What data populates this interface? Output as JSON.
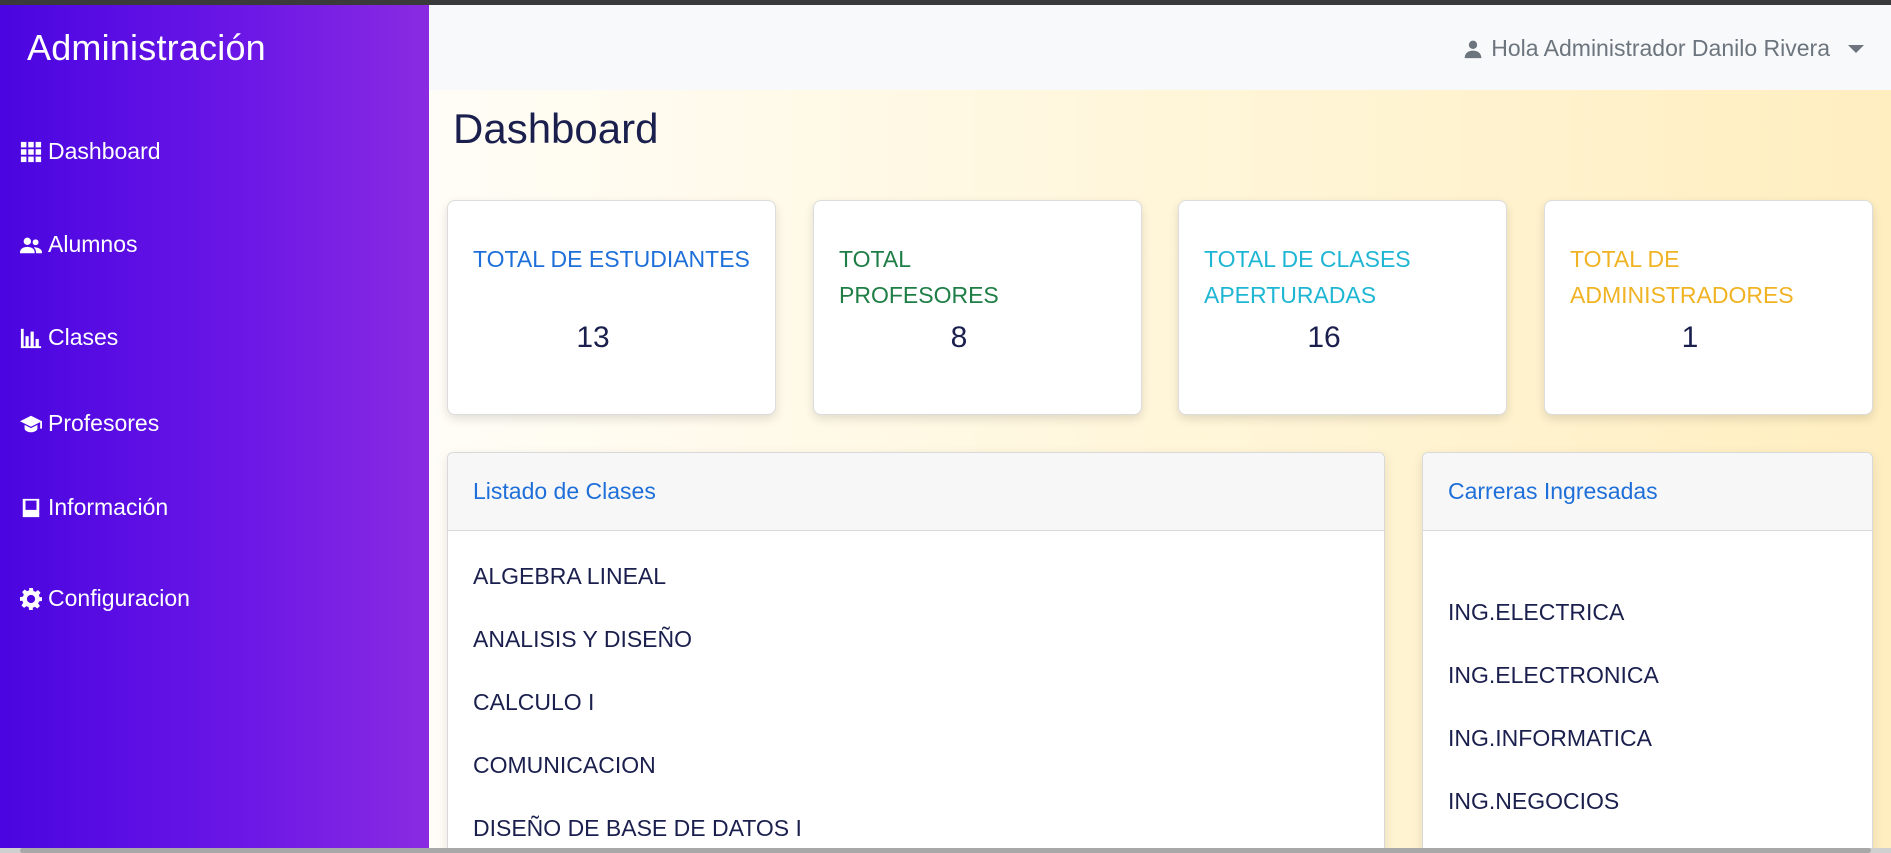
{
  "sidebar": {
    "brand": "Administración",
    "items": [
      {
        "label": "Dashboard",
        "icon": "grid-icon"
      },
      {
        "label": "Alumnos",
        "icon": "users-icon"
      },
      {
        "label": "Clases",
        "icon": "bar-chart-icon"
      },
      {
        "label": "Profesores",
        "icon": "graduation-cap-icon"
      },
      {
        "label": "Información",
        "icon": "book-icon"
      },
      {
        "label": "Configuracion",
        "icon": "gear-icon"
      }
    ]
  },
  "header": {
    "user_greeting": "Hola Administrador Danilo Rivera"
  },
  "main": {
    "title": "Dashboard",
    "stats": [
      {
        "label": "TOTAL DE ESTUDIANTES",
        "value": "13",
        "color": "#1e6fd9"
      },
      {
        "label": "TOTAL PROFESORES",
        "value": "8",
        "color": "#1e7e46"
      },
      {
        "label": "TOTAL DE CLASES APERTURADAS",
        "value": "16",
        "color": "#1fb6d4"
      },
      {
        "label": "TOTAL DE ADMINISTRADORES",
        "value": "1",
        "color": "#f0b323"
      }
    ],
    "classes_panel": {
      "title": "Listado de Clases",
      "items": [
        "ALGEBRA LINEAL",
        "ANALISIS Y DISEÑO",
        "CALCULO I",
        "COMUNICACION",
        "DISEÑO DE BASE DE DATOS I"
      ]
    },
    "careers_panel": {
      "title": "Carreras Ingresadas",
      "items": [
        "ING.ELECTRICA",
        "ING.ELECTRONICA",
        "ING.INFORMATICA",
        "ING.NEGOCIOS"
      ]
    }
  },
  "colors": {
    "sidebar_start": "#4a05e0",
    "sidebar_end": "#8a2be2",
    "link_blue": "#1e6fd9"
  }
}
